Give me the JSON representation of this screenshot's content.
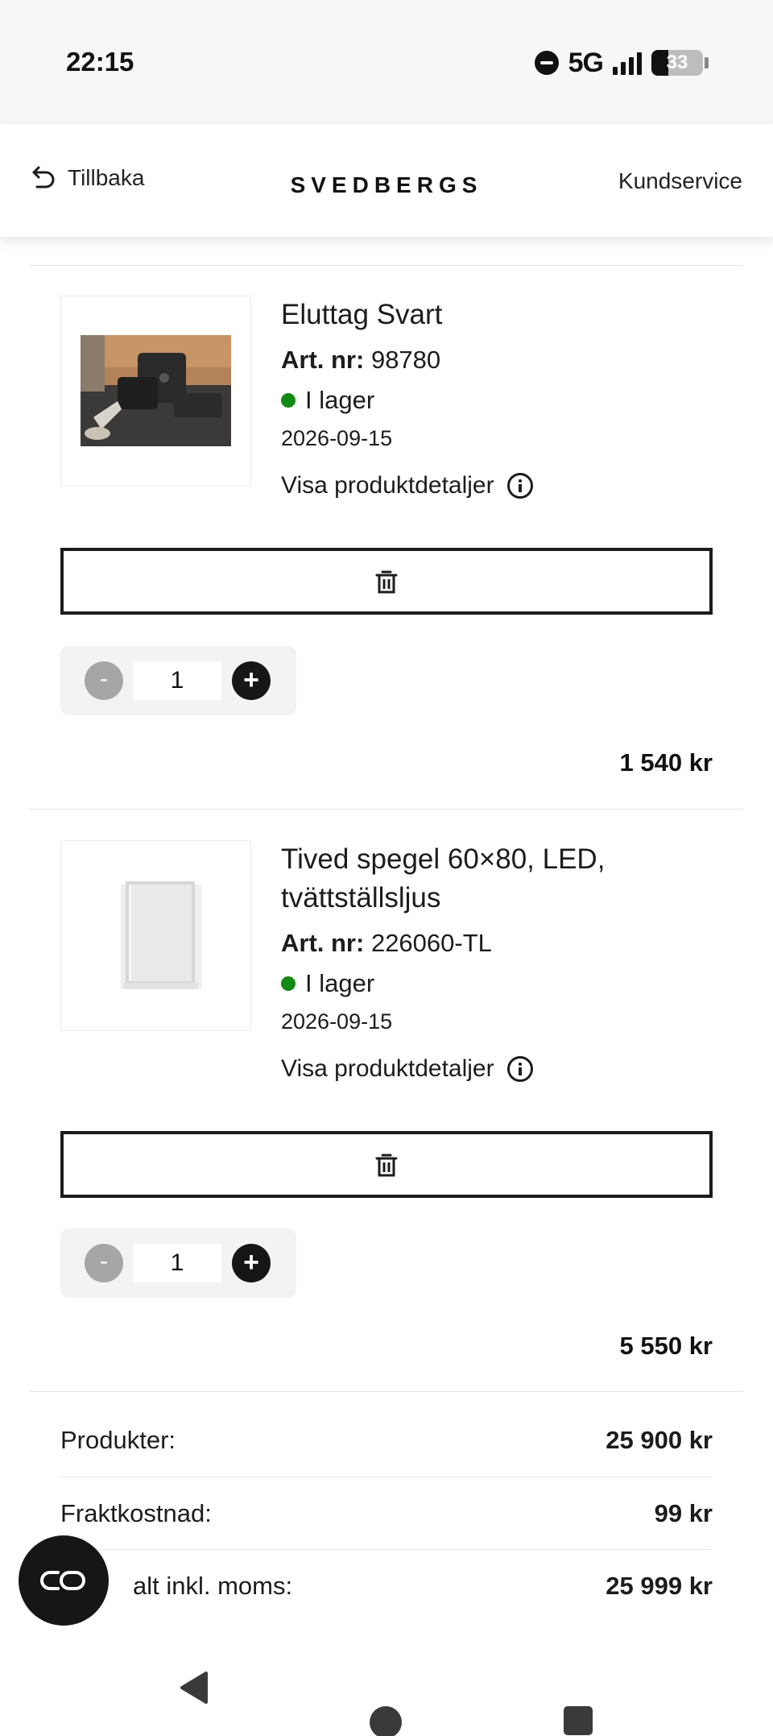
{
  "status_bar": {
    "time": "22:15",
    "network": "5G",
    "battery_level": "33",
    "battery_fraction": 0.33,
    "icons": [
      "do-not-disturb-icon",
      "signal-icon",
      "battery-icon"
    ]
  },
  "header": {
    "back_label": "Tillbaka",
    "brand": "SVEDBERGS",
    "service_label": "Kundservice"
  },
  "products": [
    {
      "title": "Eluttag Svart",
      "art_label": "Art. nr:",
      "art_number": "98780",
      "stock": "I lager",
      "date": "2026-09-15",
      "details_label": "Visa produktdetaljer",
      "quantity": "1",
      "minus": "-",
      "plus": "+",
      "price": "1 540 kr"
    },
    {
      "title": "Tived spegel 60×80, LED, tvättställsljus",
      "art_label": "Art. nr:",
      "art_number": "226060-TL",
      "stock": "I lager",
      "date": "2026-09-15",
      "details_label": "Visa produktdetaljer",
      "quantity": "1",
      "minus": "-",
      "plus": "+",
      "price": "5 550 kr"
    }
  ],
  "totals": {
    "products_label": "Produkter:",
    "products_value": "25 900 kr",
    "shipping_label": "Fraktkostnad:",
    "shipping_value": "99 kr",
    "total_label": "alt inkl. moms:",
    "total_value": "25 999 kr"
  },
  "colors": {
    "in_stock": "#138a13",
    "text": "#1c1c1c",
    "quantity_box": "#f3f3f3"
  }
}
